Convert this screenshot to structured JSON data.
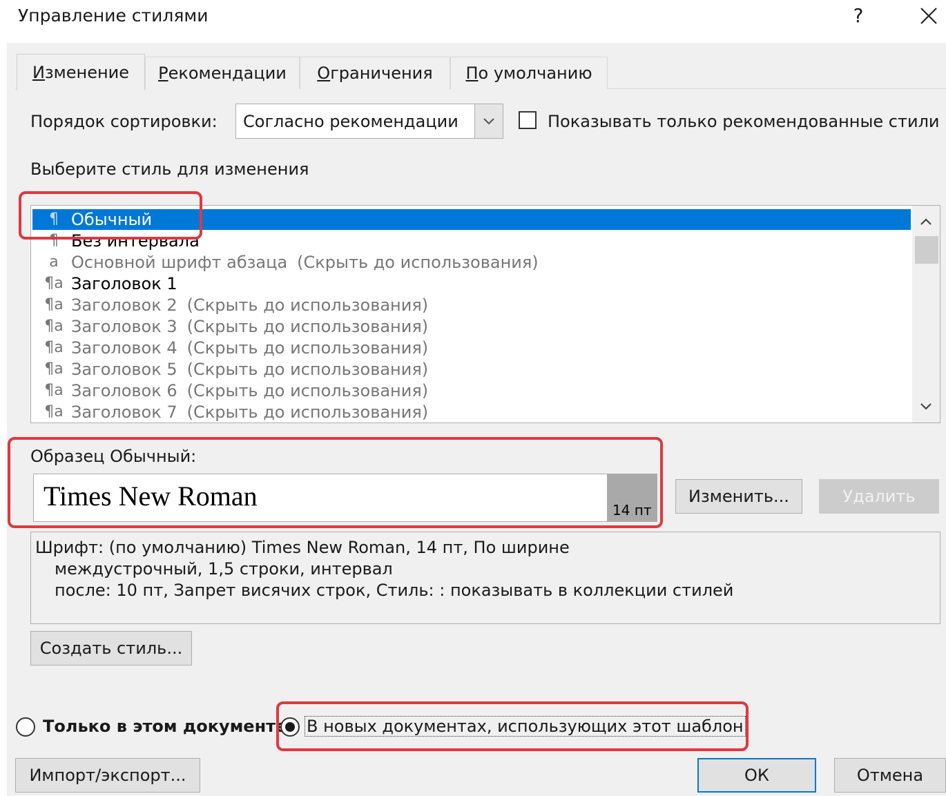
{
  "window": {
    "title": "Управление стилями",
    "help_label": "?",
    "close_label": "✕"
  },
  "tabs": [
    {
      "label": "Изменение",
      "accel": "И",
      "rest": "зменение"
    },
    {
      "label": "Рекомендации",
      "accel": "Р",
      "rest": "екомендации"
    },
    {
      "label": "Ограничения",
      "accel": "О",
      "rest": "граничения"
    },
    {
      "label": "По умолчанию",
      "accel": "П",
      "rest": "о умолчанию"
    }
  ],
  "sort": {
    "label": "Порядок сортировки:",
    "value": "Согласно рекомендации"
  },
  "recommended_only": {
    "label": "Показывать только рекомендованные стили",
    "checked": false
  },
  "style_list": {
    "label": "Выберите стиль для изменения",
    "items": [
      {
        "icon": "¶",
        "name": "Обычный",
        "hint": "",
        "selected": true
      },
      {
        "icon": "¶",
        "name": "Без интервала",
        "hint": ""
      },
      {
        "icon": "a",
        "name": "Основной шрифт абзаца",
        "hint": "(Скрыть до использования)"
      },
      {
        "icon": "¶a",
        "name": "Заголовок 1",
        "hint": ""
      },
      {
        "icon": "¶a",
        "name": "Заголовок 2",
        "hint": "(Скрыть до использования)"
      },
      {
        "icon": "¶a",
        "name": "Заголовок 3",
        "hint": "(Скрыть до использования)"
      },
      {
        "icon": "¶a",
        "name": "Заголовок 4",
        "hint": "(Скрыть до использования)"
      },
      {
        "icon": "¶a",
        "name": "Заголовок 5",
        "hint": "(Скрыть до использования)"
      },
      {
        "icon": "¶a",
        "name": "Заголовок 6",
        "hint": "(Скрыть до использования)"
      },
      {
        "icon": "¶a",
        "name": "Заголовок 7",
        "hint": "(Скрыть до использования)"
      }
    ]
  },
  "preview": {
    "label": "Образец Обычный:",
    "font_sample": "Times New Roman",
    "size": "14 пт"
  },
  "buttons": {
    "modify": "Изменить...",
    "delete": "Удалить",
    "new_style": "Создать стиль...",
    "import_export": "Импорт/экспорт...",
    "ok": "ОК",
    "cancel": "Отмена"
  },
  "description": {
    "line1": "Шрифт: (по умолчанию) Times New Roman, 14 пт, По ширине",
    "line2": "междустрочный,  1,5 строки, интервал",
    "line3": "после: 10 пт, Запрет висячих строк, Стиль: : показывать в коллекции стилей"
  },
  "scope": {
    "this_document": "Только в этом документе",
    "new_documents": "В новых документах, использующих этот шаблон",
    "selected": "new_documents"
  },
  "colors": {
    "selection": "#0078d7",
    "highlight": "#e0383e"
  }
}
